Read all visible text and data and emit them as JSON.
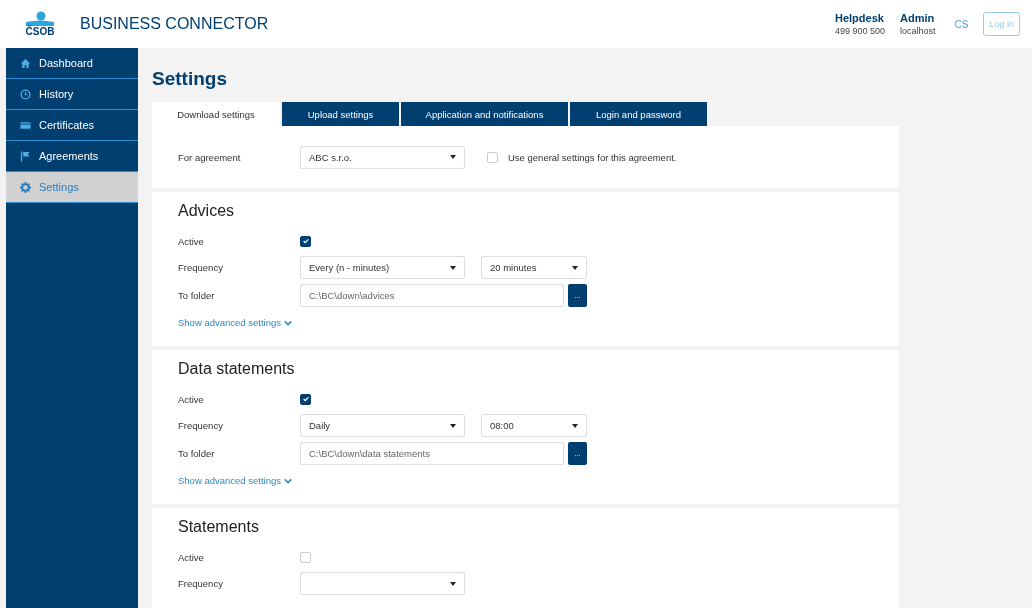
{
  "header": {
    "logo_text": "ČSOB",
    "app_title": "BUSINESS CONNECTOR",
    "helpdesk": {
      "label": "Helpdesk",
      "phone": "499 900 500"
    },
    "user": {
      "name": "Admin",
      "host": "localhost"
    },
    "language": "CS",
    "login_button": "Log in"
  },
  "sidebar": {
    "items": [
      {
        "label": "Dashboard",
        "selected": false
      },
      {
        "label": "History",
        "selected": false
      },
      {
        "label": "Certificates",
        "selected": false
      },
      {
        "label": "Agreements",
        "selected": false
      },
      {
        "label": "Settings",
        "selected": true
      }
    ]
  },
  "page_title": "Settings",
  "tabs": [
    {
      "label": "Download settings",
      "selected": true
    },
    {
      "label": "Upload settings",
      "selected": false
    },
    {
      "label": "Application and notifications",
      "selected": false
    },
    {
      "label": "Login and password",
      "selected": false
    }
  ],
  "agreement": {
    "label": "For agreement",
    "value": "ABC s.r.o.",
    "general_settings": {
      "label": "Use general settings for this agreement.",
      "checked": false
    }
  },
  "sections": [
    {
      "title": "Advices",
      "active": {
        "label": "Active",
        "checked": true
      },
      "frequency": {
        "label": "Frequency",
        "value": "Every (n - minutes)",
        "interval": "20 minutes"
      },
      "folder": {
        "label": "To folder",
        "value": "C:\\BC\\down\\advices",
        "browse": "..."
      },
      "advanced_link": "Show advanced settings"
    },
    {
      "title": "Data statements",
      "active": {
        "label": "Active",
        "checked": true
      },
      "frequency": {
        "label": "Frequency",
        "value": "Daily",
        "interval": "08:00"
      },
      "folder": {
        "label": "To folder",
        "value": "C:\\BC\\down\\data statements",
        "browse": "..."
      },
      "advanced_link": "Show advanced settings"
    },
    {
      "title": "Statements",
      "active": {
        "label": "Active",
        "checked": false
      },
      "frequency": {
        "label": "Frequency"
      }
    }
  ]
}
